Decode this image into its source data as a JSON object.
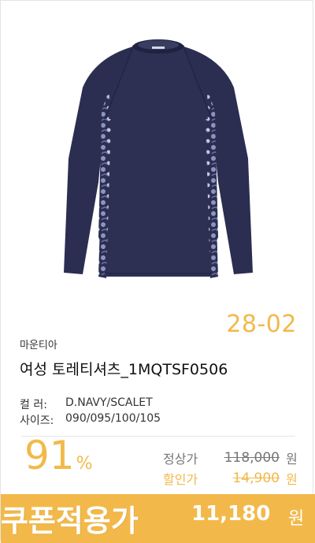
{
  "product": {
    "code": "28-02",
    "brand": "마운티아",
    "name": "여성 토레티셔츠_1MQTSF0506",
    "options": [
      {
        "key": "컬    러:",
        "value": "D.NAVY/SCALET"
      },
      {
        "key": "사이즈:",
        "value": "090/095/100/105"
      }
    ]
  },
  "pricing": {
    "discount_rate": "91",
    "discount_unit": "%",
    "regular_label": "정상가",
    "regular_price": "118,000",
    "sale_label": "할인가",
    "sale_price": "14,900",
    "currency": "원"
  },
  "coupon": {
    "label": "쿠폰적용가",
    "price": "11,180",
    "currency": "원"
  },
  "colors": {
    "accent": "#f2b94a",
    "garment": "#2c2f52"
  },
  "image": {
    "icon": "long-sleeve-shirt-icon"
  }
}
